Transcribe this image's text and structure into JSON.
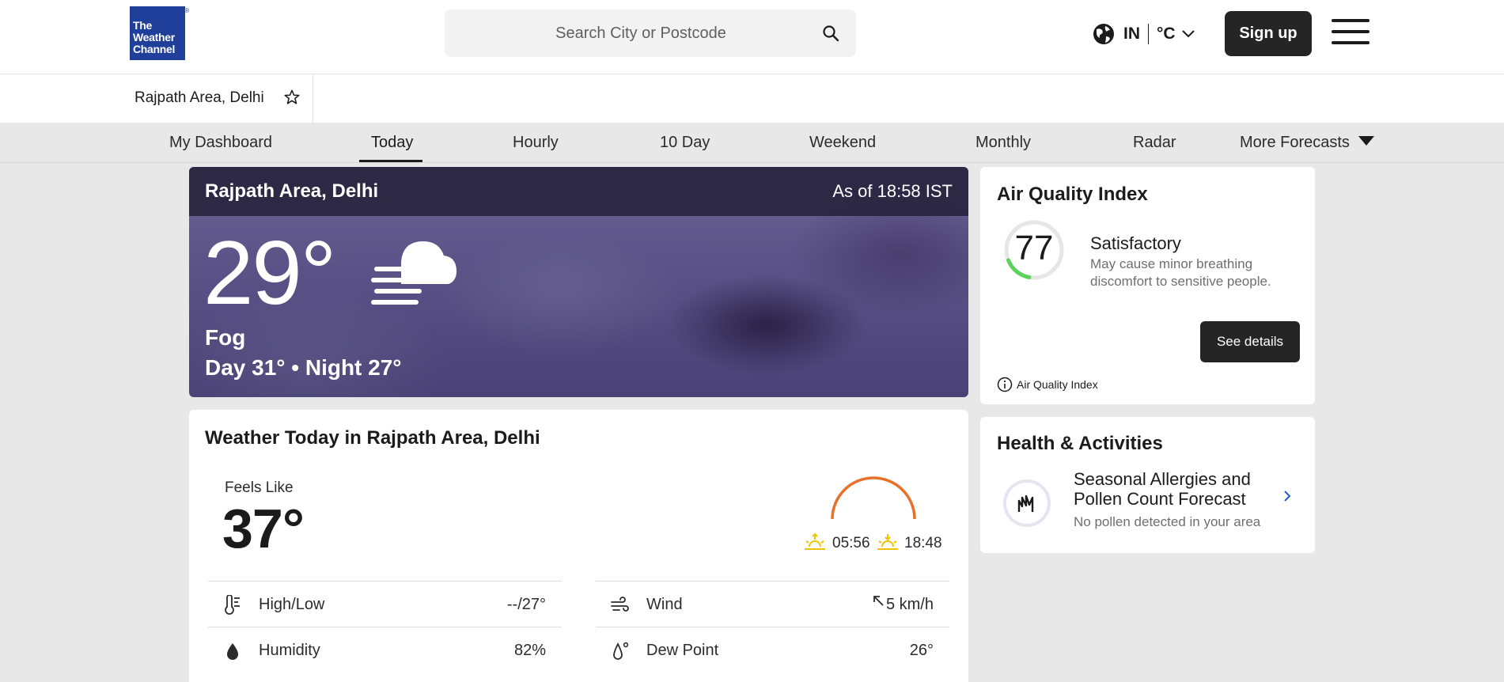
{
  "header": {
    "logo_line1": "The",
    "logo_line2": "Weather",
    "logo_line3": "Channel",
    "search_placeholder": "Search City or Postcode",
    "locale_country": "IN",
    "locale_unit": "°C",
    "signup_label": "Sign up"
  },
  "location_bar": {
    "location": "Rajpath Area, Delhi"
  },
  "nav": {
    "items": [
      "My Dashboard",
      "Today",
      "Hourly",
      "10 Day",
      "Weekend",
      "Monthly",
      "Radar",
      "More Forecasts"
    ],
    "active": "Today"
  },
  "current": {
    "location": "Rajpath Area, Delhi",
    "as_of": "As of 18:58 IST",
    "temperature": "29°",
    "phrase": "Fog",
    "day_night": "Day 31° • Night 27°",
    "icon": "fog-icon"
  },
  "today": {
    "title": "Weather Today in Rajpath Area, Delhi",
    "feels_like_label": "Feels Like",
    "feels_like_value": "37°",
    "sunrise": "05:56",
    "sunset": "18:48",
    "details": [
      {
        "label": "High/Low",
        "value": "--/27°",
        "icon": "thermometer-icon"
      },
      {
        "label": "Wind",
        "value": "5 km/h",
        "icon": "wind-icon"
      },
      {
        "label": "Humidity",
        "value": "82%",
        "icon": "humidity-icon"
      },
      {
        "label": "Dew Point",
        "value": "26°",
        "icon": "dew-point-icon"
      }
    ]
  },
  "aqi": {
    "title": "Air Quality Index",
    "value": "77",
    "category": "Satisfactory",
    "description": "May cause minor breathing discomfort to sensitive people.",
    "button_label": "See details",
    "footer_label": "Air Quality Index",
    "accent_color": "#5bd35b"
  },
  "health": {
    "title": "Health & Activities",
    "heading": "Seasonal Allergies and Pollen Count Forecast",
    "subtitle": "No pollen detected in your area"
  },
  "colors": {
    "brand_blue": "#1f3f9b",
    "sun_orange": "#e8702a",
    "sun_yellow": "#f2c200",
    "link_blue": "#1f5fd0"
  }
}
